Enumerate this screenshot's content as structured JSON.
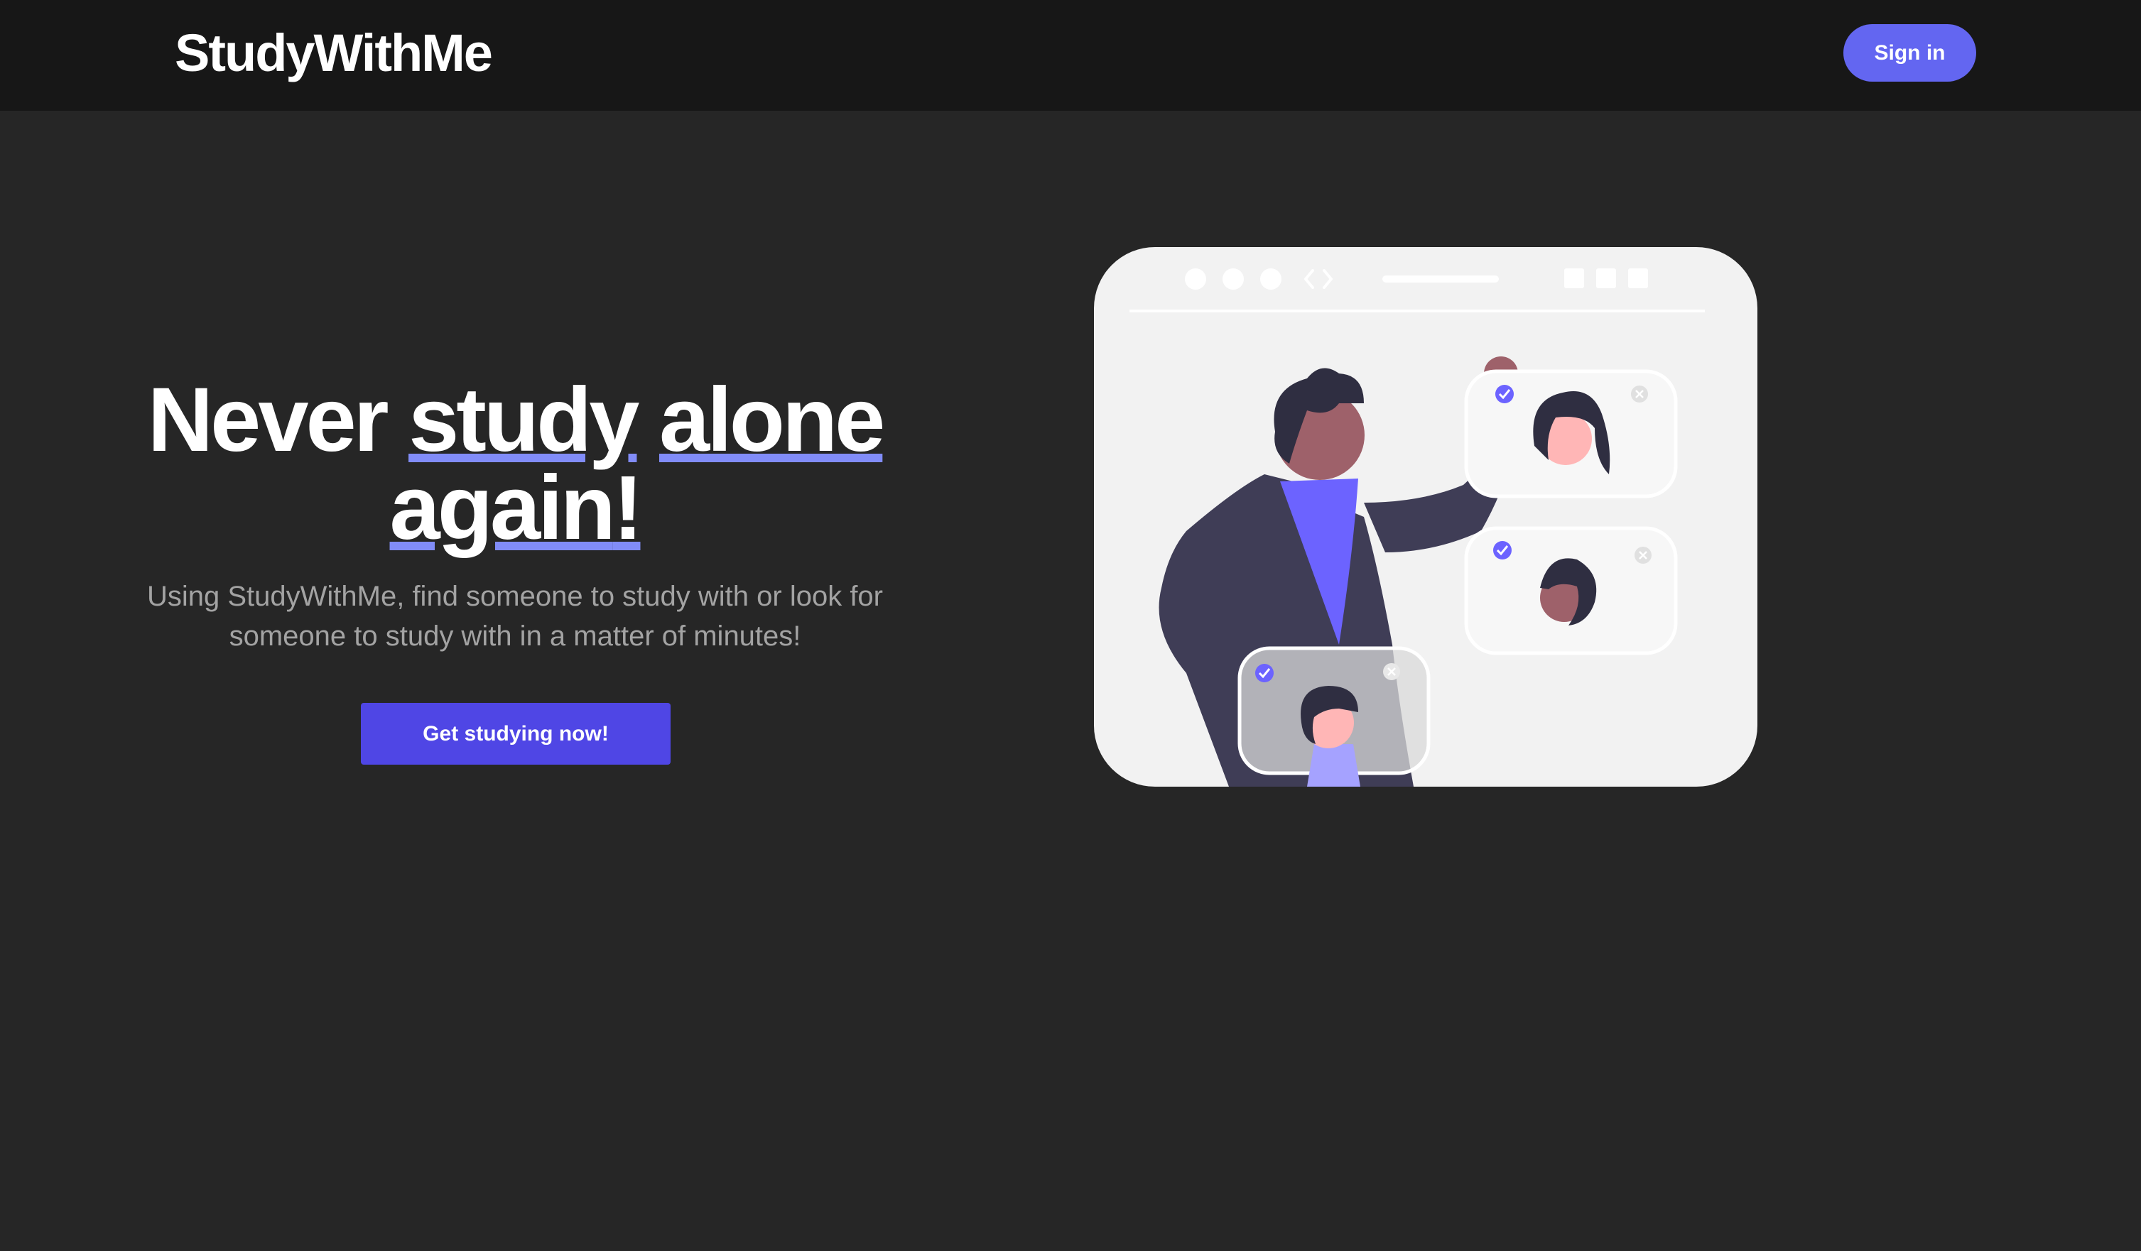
{
  "header": {
    "logo": "StudyWithMe",
    "sign_in_label": "Sign in"
  },
  "hero": {
    "headline": {
      "word1": "Never",
      "word2": "study",
      "word3": "alone",
      "word4": "again",
      "punct": "!"
    },
    "subtext": "Using StudyWithMe, find someone to study with or look for someone to study with in a matter of minutes!",
    "cta_label": "Get studying now!"
  },
  "colors": {
    "navbar_bg": "#171717",
    "page_bg": "#262626",
    "accent": "#6366f1",
    "cta_bg": "#4f46e5",
    "underline": "#818cf8",
    "subtext": "#a3a3a3"
  },
  "illustration": {
    "icons": [
      "video-call-illustration",
      "check-icon",
      "close-icon"
    ]
  }
}
